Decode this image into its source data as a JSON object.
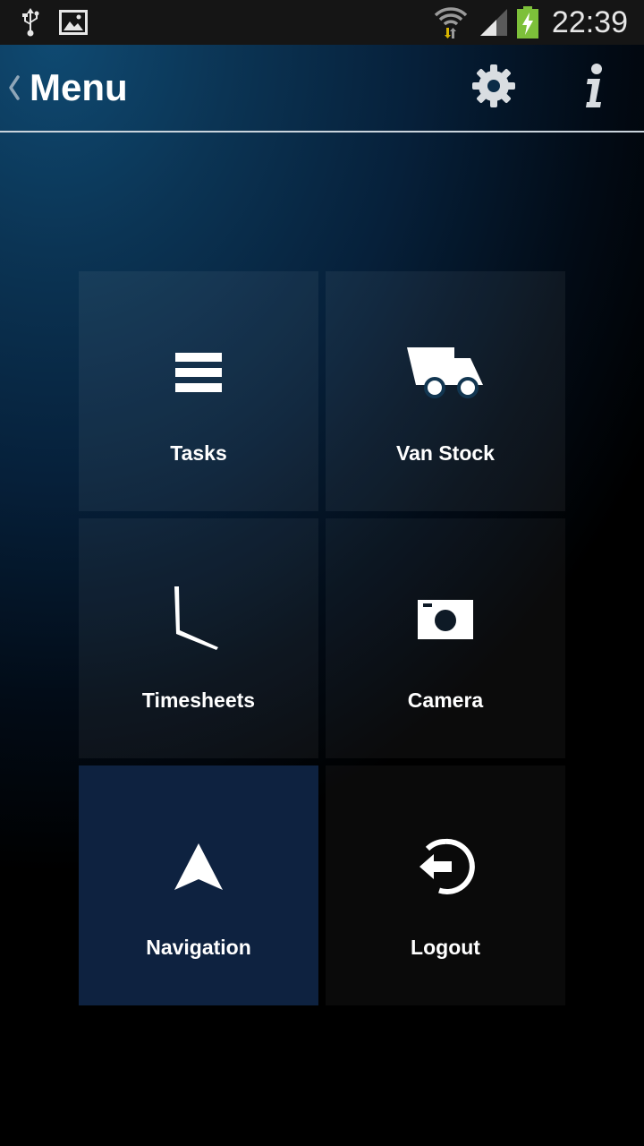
{
  "status_bar": {
    "time": "22:39",
    "icons": [
      "usb-icon",
      "image-icon",
      "wifi-icon",
      "signal-icon",
      "battery-charging-icon"
    ]
  },
  "action_bar": {
    "title": "Menu",
    "back_icon": "chevron-left-icon",
    "settings_icon": "gear-icon",
    "info_icon": "info-icon"
  },
  "menu": {
    "items": [
      {
        "label": "Tasks",
        "icon": "list-icon"
      },
      {
        "label": "Van Stock",
        "icon": "van-icon"
      },
      {
        "label": "Timesheets",
        "icon": "clock-icon"
      },
      {
        "label": "Camera",
        "icon": "camera-icon"
      },
      {
        "label": "Navigation",
        "icon": "navigation-arrow-icon",
        "highlighted": true
      },
      {
        "label": "Logout",
        "icon": "logout-icon"
      }
    ]
  },
  "colors": {
    "tile": "#ffffff0f",
    "tile_highlight": "#0e2240",
    "icon": "#ffffff",
    "status_bar": "#151515",
    "battery": "#7dc03a"
  }
}
